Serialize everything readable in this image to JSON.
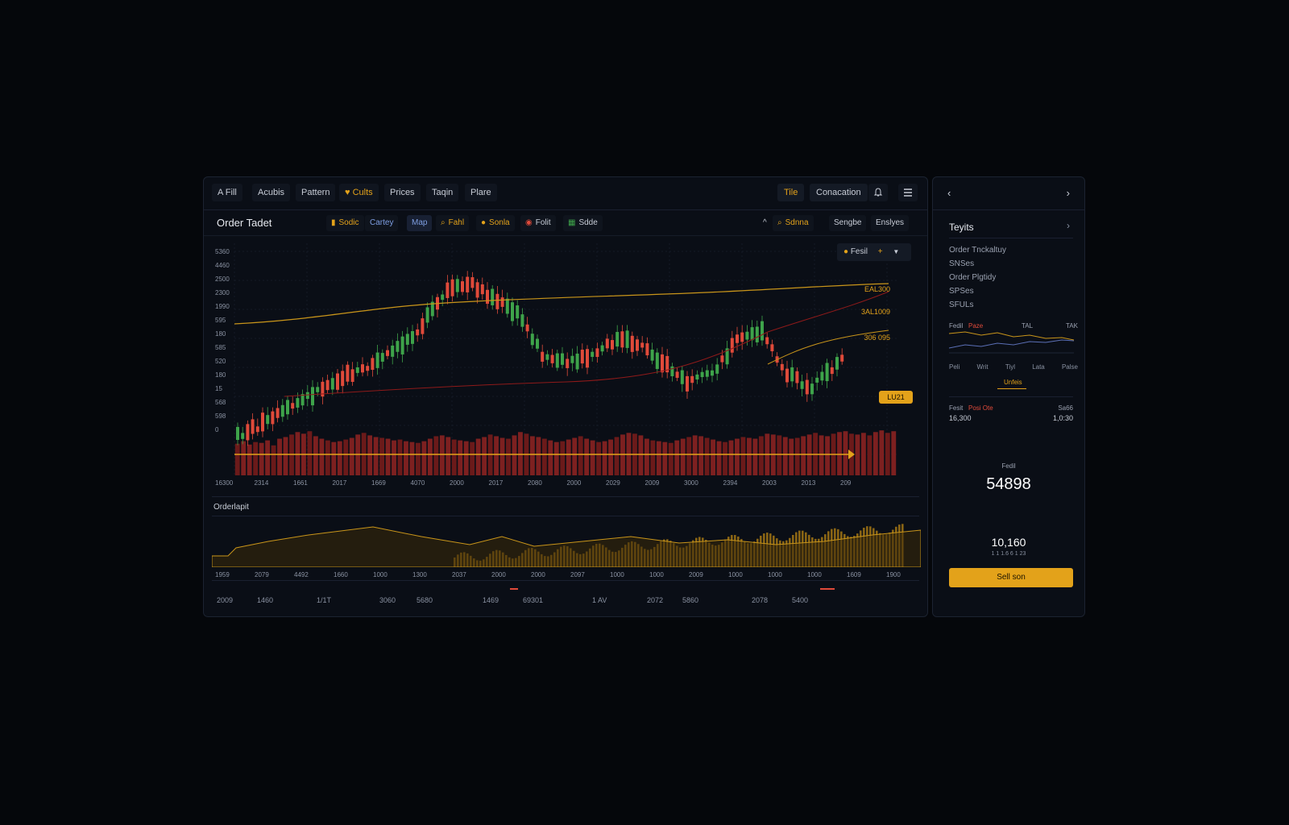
{
  "topnav": {
    "items": [
      "A Fill",
      "Acubis",
      "Pattern",
      "Cults",
      "Prices",
      "Taqin",
      "Plare"
    ],
    "tab_title": "Tile",
    "connection": "Conacation"
  },
  "toolbar": {
    "title": "Order Tadet",
    "tools": [
      "Sodic",
      "Cartey",
      "Map",
      "Fahl",
      "Sonla",
      "Folit",
      "Sdde"
    ],
    "right_tools": [
      "Sdnna",
      "Sengbe",
      "Enslyes"
    ],
    "control_label": "Fesil",
    "control_value": "+"
  },
  "chart": {
    "y_ticks": [
      "5360",
      "4460",
      "2500",
      "2300",
      "1990",
      "595",
      "180",
      "585",
      "520",
      "180",
      "15",
      "568",
      "598",
      "0"
    ],
    "x_ticks": [
      "16300",
      "2314",
      "1661",
      "2017",
      "1669",
      "4070",
      "2000",
      "2017",
      "2080",
      "2000",
      "2029",
      "2009",
      "3000",
      "2394",
      "2003",
      "2013",
      "209"
    ],
    "price_labels": [
      "EAL300",
      "3AL1009",
      "306 095"
    ],
    "marker_label": "LU21"
  },
  "chart_data": {
    "type": "bar",
    "title": "",
    "xlabel": "",
    "ylabel": "",
    "series": [
      {
        "name": "",
        "values": [
          38,
          41,
          37,
          40,
          39,
          42,
          36,
          44,
          46,
          49,
          52,
          50,
          53,
          47,
          44,
          42,
          40,
          41,
          43,
          45,
          49,
          51,
          48,
          46,
          45,
          44,
          42,
          43,
          41,
          40,
          39,
          41,
          44,
          47,
          48,
          46,
          43,
          42,
          41,
          40,
          44,
          46,
          49,
          47,
          45,
          44,
          48,
          52,
          50,
          47,
          46,
          44,
          42,
          40,
          41,
          43,
          45,
          47,
          44,
          42,
          40,
          41,
          43,
          46,
          49,
          51,
          50,
          48,
          44,
          42,
          41,
          40,
          39,
          42,
          44,
          46,
          48,
          47,
          45,
          43,
          41,
          40,
          42,
          44,
          46,
          45,
          44,
          47,
          50,
          49,
          48,
          46,
          44,
          45,
          47,
          49,
          51,
          48,
          47,
          50,
          52,
          53,
          50,
          49,
          51,
          48,
          52,
          54,
          51,
          53
        ]
      }
    ]
  },
  "depth": {
    "title": "Orderlapit",
    "x_ticks": [
      "1959",
      "2079",
      "4492",
      "1660",
      "1000",
      "1300",
      "2037",
      "2000",
      "2000",
      "2097",
      "1000",
      "1000",
      "2009",
      "1000",
      "1000",
      "1000",
      "1609",
      "1900"
    ],
    "bottom_row": [
      "2009",
      "1460",
      "1/1T",
      "3060",
      "5680",
      "1469",
      "69301",
      "1 AV",
      "2072",
      "5860",
      "2078",
      "5400"
    ]
  },
  "side": {
    "header_label": "Teyits",
    "items": [
      "Order Tnckaltuy",
      "SNSes",
      "Order Plgtidy",
      "SPSes",
      "SFULs"
    ],
    "mini_labels": [
      "Fedil",
      "Paze",
      "TAL",
      "TAK"
    ],
    "mini_x": [
      "Peli",
      "Writ",
      "Tiyl",
      "Lata",
      "Palse"
    ],
    "mini_tab": "Unfeis",
    "stats_left_label": "Fesit",
    "stats_left_tag": "Posi Ote",
    "stats_left_value": "16,300",
    "stats_right_label": "Sa66",
    "stats_right_value": "1,0:30",
    "big_label": "Fedil",
    "big_value": "54898",
    "mid_value": "10,160",
    "mid_sub": "1 1 1.6 6 1 23",
    "action_button": "Sell son"
  }
}
